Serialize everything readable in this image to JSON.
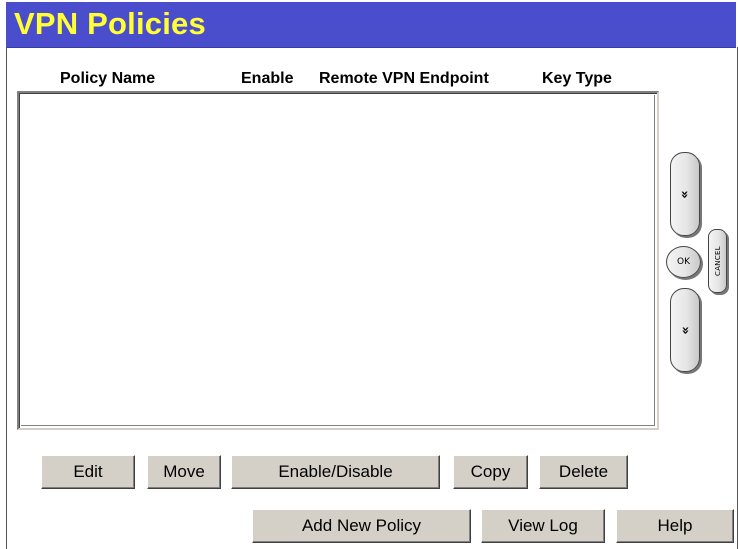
{
  "header": {
    "title": "VPN Policies"
  },
  "colors": {
    "title_bar_bg": "#4a4dcc",
    "title_text": "#ffff33",
    "button_face": "#d4d0c8"
  },
  "table": {
    "columns": [
      "Policy Name",
      "Enable",
      "Remote VPN Endpoint",
      "Key Type"
    ],
    "rows": []
  },
  "side_nav": {
    "scroll_up_glyph": "«",
    "scroll_down_glyph": "»",
    "ok_label": "OK",
    "cancel_label": "CANCEL"
  },
  "actions": {
    "edit": "Edit",
    "move": "Move",
    "enable_disable": "Enable/Disable",
    "copy": "Copy",
    "delete": "Delete"
  },
  "footer": {
    "add_new_policy": "Add New Policy",
    "view_log": "View Log",
    "help": "Help"
  }
}
